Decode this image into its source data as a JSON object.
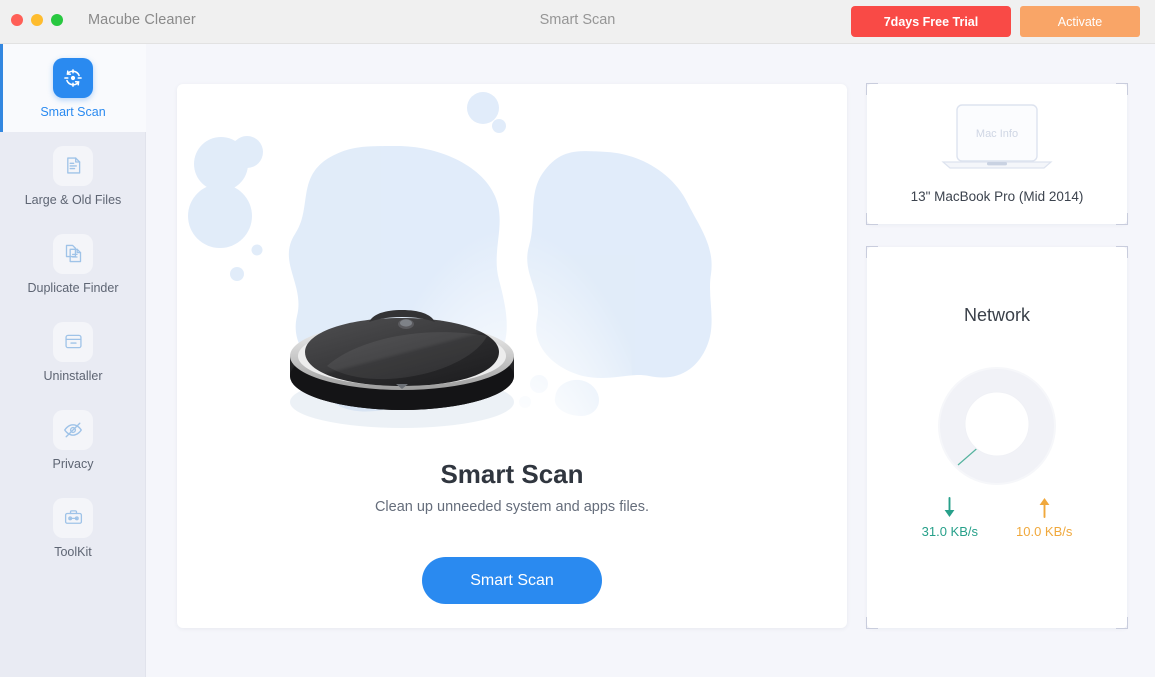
{
  "window": {
    "app_name": "Macube Cleaner",
    "title": "Smart Scan",
    "traffic_lights": [
      "close-red",
      "minimize-yellow",
      "maximize-green"
    ],
    "trial_button": "7days Free Trial",
    "activate_button": "Activate",
    "trial_color": "#f94a46",
    "activate_color": "#f9a567"
  },
  "sidebar": {
    "items": [
      {
        "label": "Smart Scan",
        "icon": "smart-scan-target-icon",
        "active": true
      },
      {
        "label": "Large & Old Files",
        "icon": "document-icon",
        "active": false
      },
      {
        "label": "Duplicate Finder",
        "icon": "duplicate-documents-icon",
        "active": false
      },
      {
        "label": "Uninstaller",
        "icon": "box-icon",
        "active": false
      },
      {
        "label": "Privacy",
        "icon": "eye-slash-icon",
        "active": false
      },
      {
        "label": "ToolKit",
        "icon": "toolbox-icon",
        "active": false
      }
    ],
    "active_color": "#2a8af0"
  },
  "main": {
    "illustration": "robot-vacuum-cleaner-illustration",
    "heading": "Smart Scan",
    "subheading": "Clean up unneeded system and apps files.",
    "scan_button": "Smart Scan",
    "button_color": "#2a8af0"
  },
  "mac_card": {
    "art_label": "Mac Info",
    "model": "13\" MacBook Pro (Mid 2014)"
  },
  "network_card": {
    "title": "Network",
    "download": {
      "value": "31.0 KB/s",
      "icon": "arrow-down-icon",
      "color": "#27a08a"
    },
    "upload": {
      "value": "10.0 KB/s",
      "icon": "arrow-up-icon",
      "color": "#f0a83c"
    }
  }
}
